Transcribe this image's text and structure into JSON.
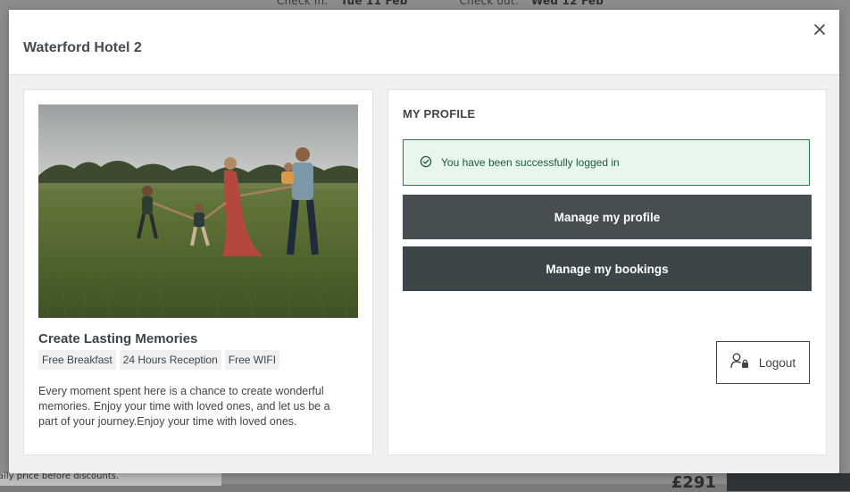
{
  "backdrop": {
    "checkin_label": "Check in:",
    "checkin_value": "Tue 11 Feb",
    "checkout_label": "Check out:",
    "checkout_value": "Wed 12 Feb",
    "note": "aily price before discounts.",
    "price": "£291"
  },
  "modal": {
    "title": "Waterford Hotel 2",
    "close_icon": "close-icon"
  },
  "hotel": {
    "image_alt": "Family walking hand in hand through a grassy field",
    "name": "Create Lasting Memories",
    "amenities": [
      "Free Breakfast",
      "24 Hours Reception",
      "Free WIFI"
    ],
    "description": "Every moment spent here is a chance to create wonderful memories. Enjoy your time with loved ones, and let us be a part of your journey.Enjoy your time with loved ones."
  },
  "profile": {
    "heading": "MY PROFILE",
    "alert_icon": "check-circle-icon",
    "alert_text": "You have been successfully logged in",
    "manage_profile_label": "Manage my profile",
    "manage_bookings_label": "Manage my bookings",
    "logout_icon": "user-lock-icon",
    "logout_label": "Logout"
  },
  "colors": {
    "button_dark": "#464e51",
    "alert_bg": "#e8f6ee",
    "alert_border": "#2c7a53",
    "text_primary": "#3e4549"
  }
}
